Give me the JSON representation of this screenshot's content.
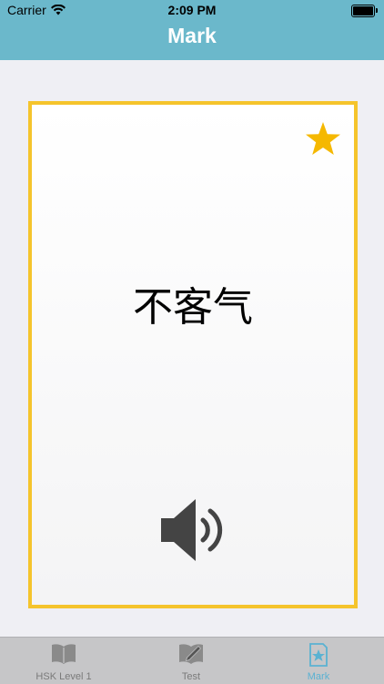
{
  "status_bar": {
    "carrier": "Carrier",
    "time": "2:09 PM"
  },
  "header": {
    "title": "Mark"
  },
  "card": {
    "word": "不客气",
    "star_icon": "star-icon",
    "speaker_icon": "speaker-icon",
    "border_color": "#f5c42c",
    "star_color": "#f5b800"
  },
  "tabs": [
    {
      "label": "HSK Level 1",
      "icon": "book-icon"
    },
    {
      "label": "Test",
      "icon": "pencil-book-icon"
    },
    {
      "label": "Mark",
      "icon": "star-bookmark-icon"
    }
  ],
  "colors": {
    "header": "#6bb8cb",
    "active_tab": "#5ab2d2"
  }
}
